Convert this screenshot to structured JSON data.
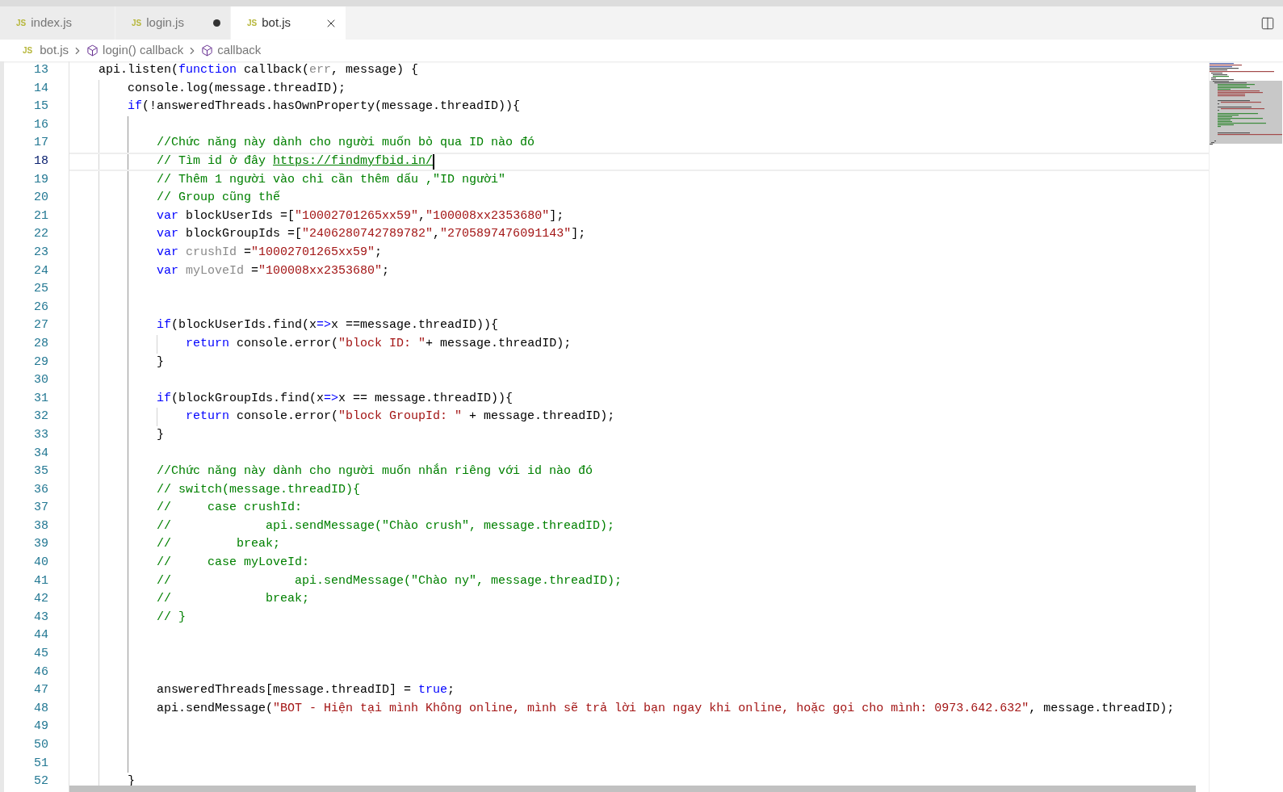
{
  "tabs": [
    {
      "icon_text": "JS",
      "label": "index.js",
      "selected": false,
      "modified": false
    },
    {
      "icon_text": "JS",
      "label": "login.js",
      "selected": false,
      "modified": true
    },
    {
      "icon_text": "JS",
      "label": "bot.js",
      "selected": true,
      "modified": false
    }
  ],
  "breadcrumb": [
    {
      "kind": "file",
      "icon_text": "JS",
      "label": "bot.js"
    },
    {
      "kind": "symbol",
      "label": "login() callback"
    },
    {
      "kind": "symbol",
      "label": "callback"
    }
  ],
  "lines": [
    {
      "number": "13",
      "current": false,
      "tokens": [
        {
          "kind": "plain",
          "text": "    api.listen("
        },
        {
          "kind": "keyword",
          "text": "function"
        },
        {
          "kind": "plain",
          "text": " callback("
        },
        {
          "kind": "unused",
          "text": "err"
        },
        {
          "kind": "plain",
          "text": ", message) {"
        }
      ]
    },
    {
      "number": "14",
      "current": false,
      "tokens": [
        {
          "kind": "plain",
          "text": "        console.log(message.threadID);"
        }
      ]
    },
    {
      "number": "15",
      "current": false,
      "tokens": [
        {
          "kind": "keyword",
          "text": "        if"
        },
        {
          "kind": "plain",
          "text": "(!answeredThreads.hasOwnProperty(message.threadID)){"
        }
      ]
    },
    {
      "number": "16",
      "current": false
    },
    {
      "number": "17",
      "current": false,
      "tokens": [
        {
          "kind": "comment",
          "text": "            //Chức năng này dành cho người muốn bỏ qua ID nào đó"
        }
      ]
    },
    {
      "number": "18",
      "current": true,
      "tokens": [
        {
          "kind": "comment",
          "text": "            // Tìm id ở đây "
        },
        {
          "kind": "link",
          "text": "https://findmyfbid.in/"
        }
      ]
    },
    {
      "number": "19",
      "current": false,
      "tokens": [
        {
          "kind": "comment",
          "text": "            // Thêm 1 người vào chỉ cần thêm dấu ,\"ID người\""
        }
      ]
    },
    {
      "number": "20",
      "current": false,
      "tokens": [
        {
          "kind": "comment",
          "text": "            // Group cũng thế"
        }
      ]
    },
    {
      "number": "21",
      "current": false,
      "tokens": [
        {
          "kind": "keyword",
          "text": "            var"
        },
        {
          "kind": "plain",
          "text": " blockUserIds =["
        },
        {
          "kind": "string",
          "text": "\"10002701265xx59\""
        },
        {
          "kind": "plain",
          "text": ","
        },
        {
          "kind": "string",
          "text": "\"100008xx2353680\""
        },
        {
          "kind": "plain",
          "text": "];"
        }
      ]
    },
    {
      "number": "22",
      "current": false,
      "tokens": [
        {
          "kind": "keyword",
          "text": "            var"
        },
        {
          "kind": "plain",
          "text": " blockGroupIds =["
        },
        {
          "kind": "string",
          "text": "\"2406280742789782\""
        },
        {
          "kind": "plain",
          "text": ","
        },
        {
          "kind": "string",
          "text": "\"2705897476091143\""
        },
        {
          "kind": "plain",
          "text": "];"
        }
      ]
    },
    {
      "number": "23",
      "current": false,
      "tokens": [
        {
          "kind": "keyword",
          "text": "            var"
        },
        {
          "kind": "unused",
          "text": " crushId"
        },
        {
          "kind": "plain",
          "text": " ="
        },
        {
          "kind": "string",
          "text": "\"10002701265xx59\""
        },
        {
          "kind": "plain",
          "text": ";"
        }
      ]
    },
    {
      "number": "24",
      "current": false,
      "tokens": [
        {
          "kind": "keyword",
          "text": "            var"
        },
        {
          "kind": "unused",
          "text": " myLoveId"
        },
        {
          "kind": "plain",
          "text": " ="
        },
        {
          "kind": "string",
          "text": "\"100008xx2353680\""
        },
        {
          "kind": "plain",
          "text": ";"
        }
      ]
    },
    {
      "number": "25",
      "current": false
    },
    {
      "number": "26",
      "current": false
    },
    {
      "number": "27",
      "current": false,
      "tokens": [
        {
          "kind": "keyword",
          "text": "            if"
        },
        {
          "kind": "plain",
          "text": "(blockUserIds.find(x"
        },
        {
          "kind": "keyword",
          "text": "=>"
        },
        {
          "kind": "plain",
          "text": "x ==message.threadID)){"
        }
      ]
    },
    {
      "number": "28",
      "current": false,
      "tokens": [
        {
          "kind": "keyword",
          "text": "                return"
        },
        {
          "kind": "plain",
          "text": " console.error("
        },
        {
          "kind": "string",
          "text": "\"block ID: \""
        },
        {
          "kind": "plain",
          "text": "+ message.threadID);"
        }
      ]
    },
    {
      "number": "29",
      "current": false,
      "tokens": [
        {
          "kind": "plain",
          "text": "            }"
        }
      ]
    },
    {
      "number": "30",
      "current": false
    },
    {
      "number": "31",
      "current": false,
      "tokens": [
        {
          "kind": "keyword",
          "text": "            if"
        },
        {
          "kind": "plain",
          "text": "(blockGroupIds.find(x"
        },
        {
          "kind": "keyword",
          "text": "=>"
        },
        {
          "kind": "plain",
          "text": "x == message.threadID)){"
        }
      ]
    },
    {
      "number": "32",
      "current": false,
      "tokens": [
        {
          "kind": "keyword",
          "text": "                return"
        },
        {
          "kind": "plain",
          "text": " console.error("
        },
        {
          "kind": "string",
          "text": "\"block GroupId: \""
        },
        {
          "kind": "plain",
          "text": " + message.threadID);"
        }
      ]
    },
    {
      "number": "33",
      "current": false,
      "tokens": [
        {
          "kind": "plain",
          "text": "            }"
        }
      ]
    },
    {
      "number": "34",
      "current": false
    },
    {
      "number": "35",
      "current": false,
      "tokens": [
        {
          "kind": "comment",
          "text": "            //Chức năng này dành cho người muốn nhắn riêng với id nào đó"
        }
      ]
    },
    {
      "number": "36",
      "current": false,
      "tokens": [
        {
          "kind": "comment",
          "text": "            // switch(message.threadID){"
        }
      ]
    },
    {
      "number": "37",
      "current": false,
      "tokens": [
        {
          "kind": "comment",
          "text": "            //     case crushId:"
        }
      ]
    },
    {
      "number": "38",
      "current": false,
      "tokens": [
        {
          "kind": "comment",
          "text": "            //             api.sendMessage(\"Chào crush\", message.threadID);"
        }
      ]
    },
    {
      "number": "39",
      "current": false,
      "tokens": [
        {
          "kind": "comment",
          "text": "            //         break;"
        }
      ]
    },
    {
      "number": "40",
      "current": false,
      "tokens": [
        {
          "kind": "comment",
          "text": "            //     case myLoveId:"
        }
      ]
    },
    {
      "number": "41",
      "current": false,
      "tokens": [
        {
          "kind": "comment",
          "text": "            //                 api.sendMessage(\"Chào ny\", message.threadID);"
        }
      ]
    },
    {
      "number": "42",
      "current": false,
      "tokens": [
        {
          "kind": "comment",
          "text": "            //             break;"
        }
      ]
    },
    {
      "number": "43",
      "current": false,
      "tokens": [
        {
          "kind": "comment",
          "text": "            // }"
        }
      ]
    },
    {
      "number": "44",
      "current": false
    },
    {
      "number": "45",
      "current": false
    },
    {
      "number": "46",
      "current": false
    },
    {
      "number": "47",
      "current": false,
      "tokens": [
        {
          "kind": "plain",
          "text": "            answeredThreads[message.threadID] = "
        },
        {
          "kind": "keyword",
          "text": "true"
        },
        {
          "kind": "plain",
          "text": ";"
        }
      ]
    },
    {
      "number": "48",
      "current": false,
      "tokens": [
        {
          "kind": "plain",
          "text": "            api.sendMessage("
        },
        {
          "kind": "string",
          "text": "\"BOT - Hiện tại mình Không online, mình sẽ trả lời bạn ngay khi online, hoặc gọi cho mình: 0973.642.632\""
        },
        {
          "kind": "plain",
          "text": ", message.threadID);"
        }
      ]
    },
    {
      "number": "49",
      "current": false
    },
    {
      "number": "50",
      "current": false
    },
    {
      "number": "51",
      "current": false
    },
    {
      "number": "52",
      "current": false,
      "tokens": [
        {
          "kind": "plain",
          "text": "        }"
        }
      ]
    }
  ]
}
